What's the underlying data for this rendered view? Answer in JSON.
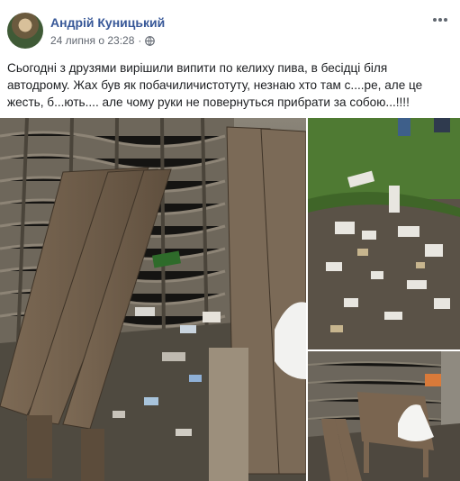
{
  "post": {
    "author": "Андрій Куницький",
    "date": "24 липня о 23:28",
    "separator": "·",
    "text": "Сьогодні з друзями вирішили випити по келиху пива, в бесідці біля автодрому. Жах був як побачиличистотуту, незнаю хто там с....ре, але це жесть, б...ють.... але чому руки не повернуться прибрати за собою...!!!!"
  },
  "icons": {
    "more": "more-horizontal-icon",
    "privacy": "globe-icon"
  },
  "colors": {
    "author": "#385898",
    "meta": "#616770",
    "text": "#1c1e21"
  }
}
